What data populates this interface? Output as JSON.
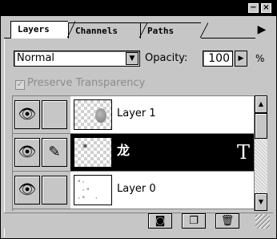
{
  "palette": {
    "title_buttons": {
      "minimize": "−",
      "close": "×"
    },
    "tabs": [
      {
        "label": "Layers",
        "active": true
      },
      {
        "label": "Channels",
        "active": false
      },
      {
        "label": "Paths",
        "active": false
      }
    ],
    "menu_arrow": "▶"
  },
  "controls": {
    "mode": "Normal",
    "mode_arrow": "▼",
    "opacity_label": "Opacity:",
    "opacity_value": "100",
    "opacity_arrow": "▶",
    "opacity_unit": "%",
    "preserve_check": "✓",
    "preserve_label": "Preserve Transparency",
    "preserve_checked": true,
    "preserve_disabled": true
  },
  "layers": [
    {
      "name": "Layer 1",
      "visible": true,
      "eye_icon": "👁",
      "link_icon": "",
      "selected": false
    },
    {
      "name": "龙",
      "visible": true,
      "eye_icon": "👁",
      "link_icon": "✎",
      "selected": true,
      "type_glyph": "T",
      "thumb_mark": "*"
    },
    {
      "name": "Layer 0",
      "visible": true,
      "eye_icon": "👁",
      "link_icon": "",
      "selected": false,
      "thumb_specks": "ᵃ·\n ·ᵃ\n·ᵃ  ·"
    }
  ],
  "scrollbar": {
    "up": "▲",
    "down": "▼"
  },
  "bottom_buttons": {
    "mask": "◙",
    "new_layer": "❐",
    "trash": "🗑"
  },
  "colors": {
    "panel": "#c6c6c6",
    "selected_row": "#000000",
    "disabled_text": "#8c8c8c"
  }
}
